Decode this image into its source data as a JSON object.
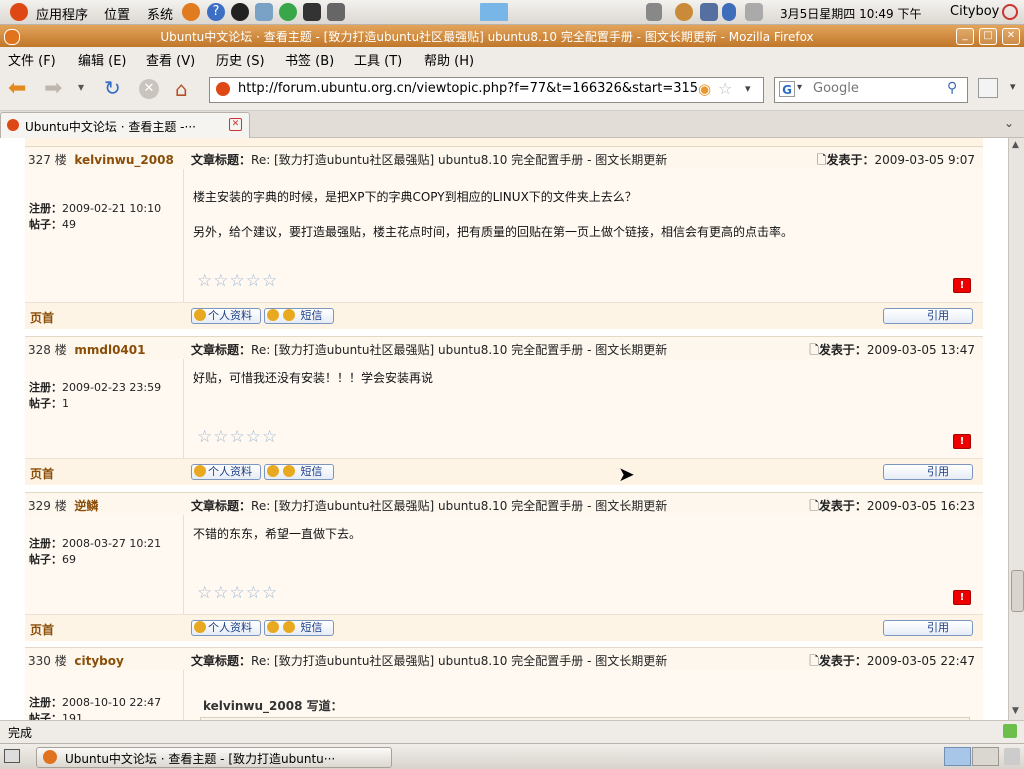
{
  "panel": {
    "applications": "应用程序",
    "places": "位置",
    "system": "系统",
    "datetime": "3月5日星期四 10:49 下午",
    "user": "Cityboy"
  },
  "window": {
    "title": "Ubuntu中文论坛 · 查看主题 - [致力打造ubuntu社区最强贴] ubuntu8.10 完全配置手册 - 图文长期更新 - Mozilla Firefox"
  },
  "menubar": [
    "文件 (F)",
    "编辑 (E)",
    "查看 (V)",
    "历史 (S)",
    "书签 (B)",
    "工具 (T)",
    "帮助 (H)"
  ],
  "navbar": {
    "url": "http://forum.ubuntu.org.cn/viewtopic.php?f=77&t=166326&start=315",
    "search_placeholder": "Google"
  },
  "tab": {
    "label": "Ubuntu中文论坛 · 查看主题 -···"
  },
  "labels": {
    "subject": "文章标题：",
    "posted": "发表于：",
    "registered": "注册：",
    "posts": "帖子：",
    "home": "页首",
    "profile": "个人资料",
    "pm": "短信",
    "quote": "引用",
    "stars": "☆☆☆☆☆",
    "report": "!",
    "wrote": "写道："
  },
  "posts": [
    {
      "floor": "327 楼",
      "user": "kelvinwu_2008",
      "subject": "Re: [致力打造ubuntu社区最强贴] ubuntu8.10 完全配置手册 - 图文长期更新",
      "posted_at": "2009-03-05 9:07",
      "registered": "2009-02-21 10:10",
      "post_count": "49",
      "lines": [
        "楼主安装的字典的时候，是把XP下的字典COPY到相应的LINUX下的文件夹上去么？",
        "另外，给个建议，要打造最强贴，楼主花点时间，把有质量的回贴在第一页上做个链接，相信会有更高的点击率。"
      ]
    },
    {
      "floor": "328 楼",
      "user": "mmdl0401",
      "subject": "Re: [致力打造ubuntu社区最强贴] ubuntu8.10 完全配置手册 - 图文长期更新",
      "posted_at": "2009-03-05 13:47",
      "registered": "2009-02-23 23:59",
      "post_count": "1",
      "lines": [
        "好贴，可惜我还没有安装！！！学会安装再说"
      ]
    },
    {
      "floor": "329 楼",
      "user": "逆鳞",
      "subject": "Re: [致力打造ubuntu社区最强贴] ubuntu8.10 完全配置手册 - 图文长期更新",
      "posted_at": "2009-03-05 16:23",
      "registered": "2008-03-27 10:21",
      "post_count": "69",
      "lines": [
        "不错的东东，希望一直做下去。"
      ]
    },
    {
      "floor": "330 楼",
      "user": "cityboy",
      "subject": "Re: [致力打造ubuntu社区最强贴] ubuntu8.10 完全配置手册 - 图文长期更新",
      "posted_at": "2009-03-05 22:47",
      "registered": "2008-10-10 22:47",
      "post_count": "191",
      "quote_author": "kelvinwu_2008"
    }
  ],
  "status": {
    "text": "完成"
  },
  "taskbar": {
    "window_label": "Ubuntu中文论坛 · 查看主题 - [致力打造ubuntu···"
  }
}
